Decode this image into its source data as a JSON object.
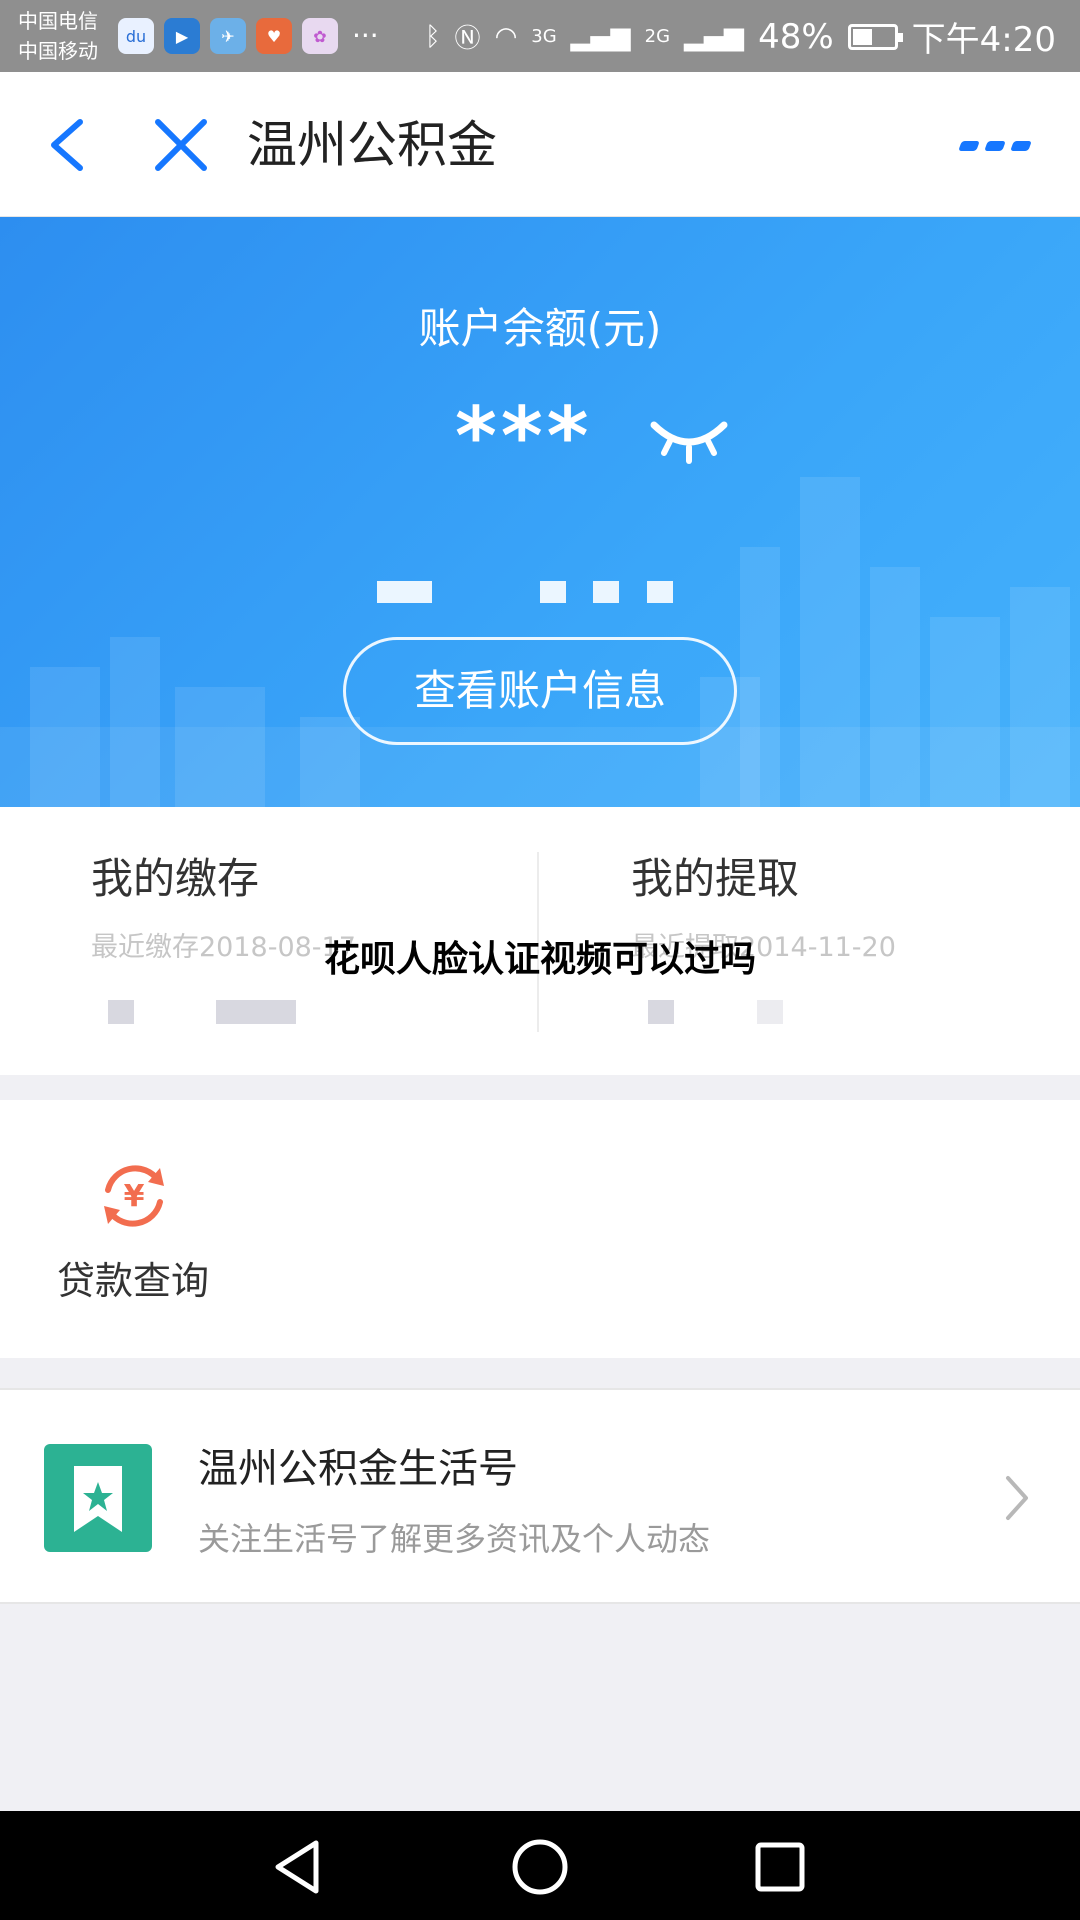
{
  "status_bar": {
    "carrier_1": "中国电信",
    "carrier_2": "中国移动",
    "app_icons": [
      "baidu-app-icon",
      "video-app-icon",
      "telegram-app-icon",
      "heart-app-icon",
      "gallery-app-icon"
    ],
    "more_notifications": "···",
    "network_1": "3G",
    "network_2": "2G",
    "battery": "48%",
    "battery_level": 0.48,
    "time": "下午4:20"
  },
  "nav": {
    "title": "温州公积金"
  },
  "balance": {
    "label": "账户余额(元)",
    "masked_value": "***",
    "view_button": "查看账户信息"
  },
  "stats": {
    "deposit": {
      "title": "我的缴存",
      "subtitle": "最近缴存2018-08-17"
    },
    "withdraw": {
      "title": "我的提取",
      "subtitle": "最近提取2014-11-20"
    }
  },
  "overlay_caption": "花呗人脸认证视频可以过吗",
  "loan": {
    "label": "贷款查询"
  },
  "life_account": {
    "title": "温州公积金生活号",
    "description": "关注生活号了解更多资讯及个人动态"
  },
  "colors": {
    "accent": "#1677ff",
    "balance_bg": "#3aa6f9",
    "loan_icon": "#f26d4f",
    "life_icon": "#2cb293"
  }
}
